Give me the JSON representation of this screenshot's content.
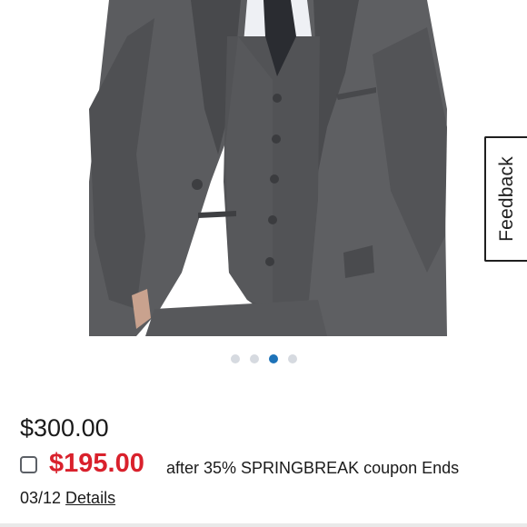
{
  "product_image": {
    "alt": "",
    "icon": "suit-photo"
  },
  "feedback": {
    "label": "Feedback"
  },
  "carousel": {
    "total": 4,
    "active_index": 2,
    "active_color": "#1d72b8",
    "inactive_color": "#d6dae0"
  },
  "pricing": {
    "original_price": "$300.00",
    "sale_price": "$195.00",
    "sale_color": "#d9212c",
    "coupon_text": "after 35% SPRINGBREAK coupon Ends",
    "coupon_end_date": "03/12",
    "details_link": "Details"
  }
}
